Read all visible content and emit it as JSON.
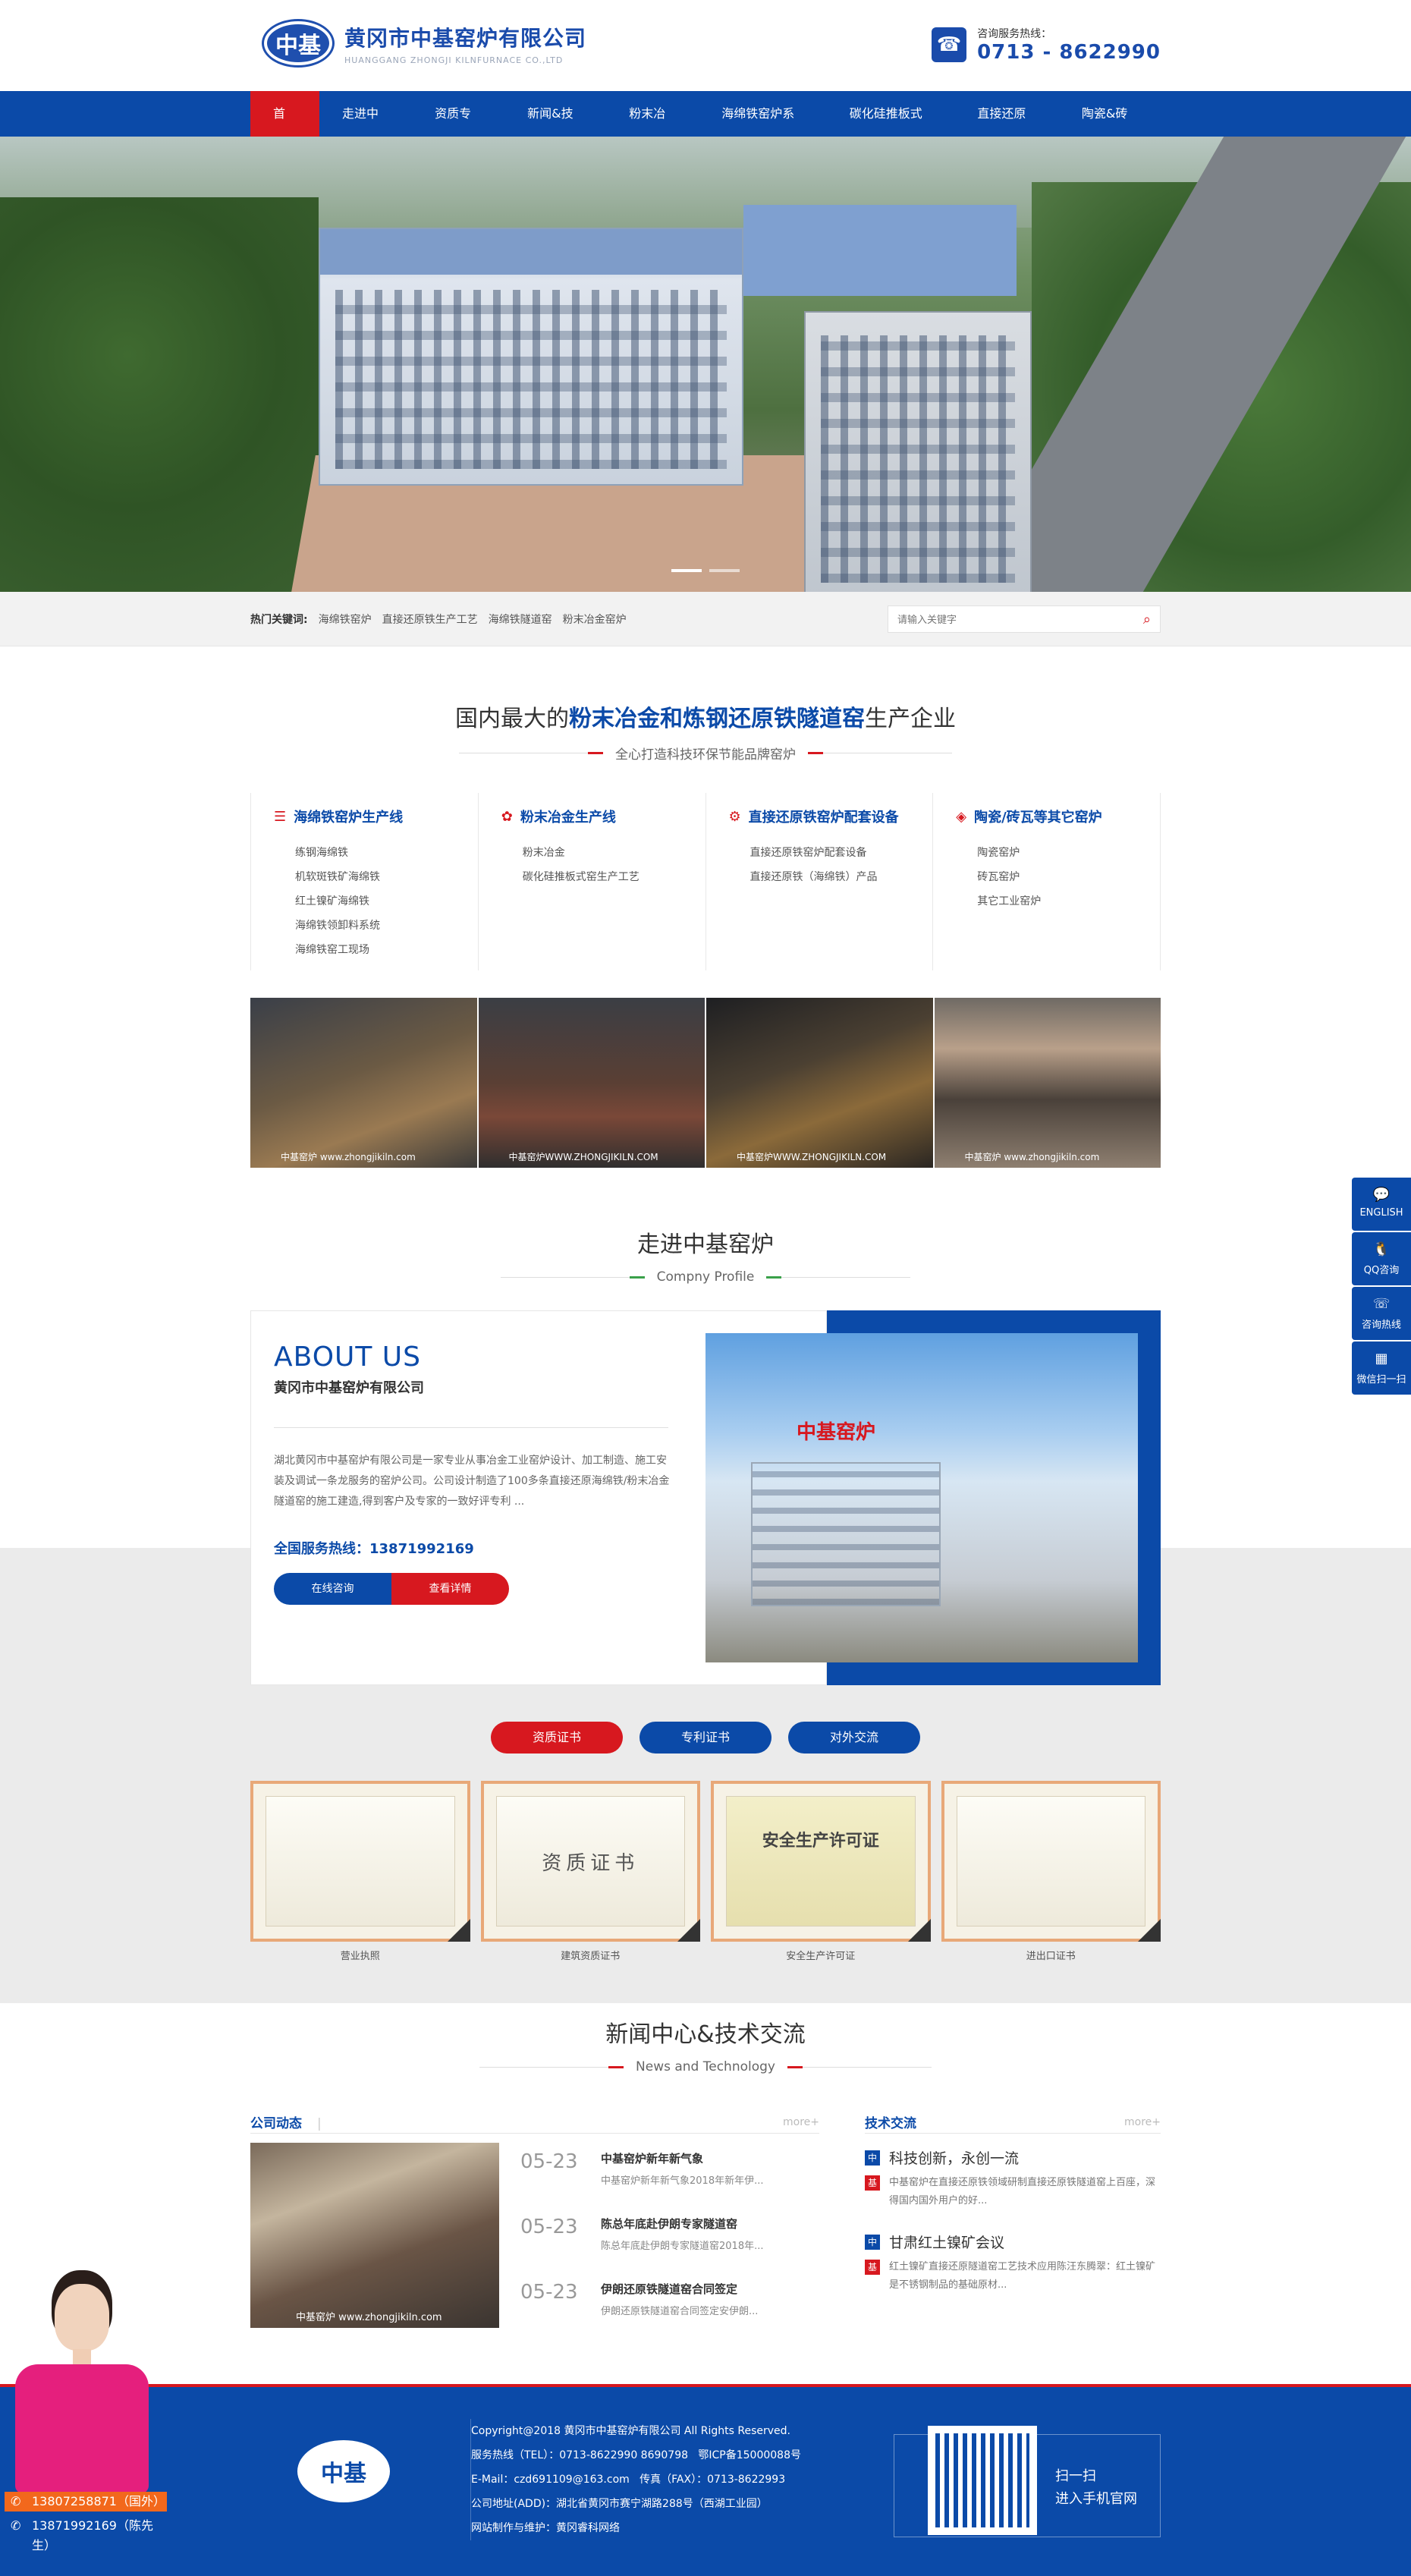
{
  "header": {
    "logo_mark": "中基",
    "company_cn": "黄冈市中基窑炉有限公司",
    "company_en": "HUANGGANG ZHONGJI KILNFURNACE CO.,LTD",
    "hotline_label": "咨询服务热线：",
    "hotline_number": "0713 - 8622990",
    "phone_icon": "telephone-icon"
  },
  "nav": {
    "items": [
      {
        "label": "首页",
        "active": true
      },
      {
        "label": "走进中基"
      },
      {
        "label": "资质专利"
      },
      {
        "label": "新闻&技术"
      },
      {
        "label": "粉末冶金"
      },
      {
        "label": "海绵铁窑炉系列"
      },
      {
        "label": "碳化硅推板式窑"
      },
      {
        "label": "直接还原铁"
      },
      {
        "label": "陶瓷&砖瓦"
      }
    ]
  },
  "search": {
    "hot_label": "热门关键词:",
    "hot_words": [
      "海绵铁窑炉",
      "直接还原铁生产工艺",
      "海绵铁隧道窑",
      "粉末冶金窑炉"
    ],
    "placeholder": "请输入关键字",
    "icon": "search-icon"
  },
  "products": {
    "title_pre": "国内最大的",
    "title_hl": "粉末冶金和炼钢还原铁隧道窑",
    "title_post": "生产企业",
    "subtitle": "全心打造科技环保节能品牌窑炉",
    "categories": [
      {
        "title": "海绵铁窑炉生产线",
        "icon": "list-icon",
        "items": [
          "练钢海绵铁",
          "机软斑铁矿海绵铁",
          "红土镍矿海绵铁",
          "海绵铁领卸料系统",
          "海绵铁窑工现场"
        ]
      },
      {
        "title": "粉末冶金生产线",
        "icon": "flower-icon",
        "items": [
          "粉末冶金",
          "碳化硅推板式窑生产工艺"
        ]
      },
      {
        "title": "直接还原铁窑炉配套设备",
        "icon": "gear-icon",
        "items": [
          "直接还原铁窑炉配套设备",
          "直接还原铁（海绵铁）产品"
        ]
      },
      {
        "title": "陶瓷/砖瓦等其它窑炉",
        "icon": "tag-icon",
        "items": [
          "陶瓷窑炉",
          "砖瓦窑炉",
          "其它工业窑炉"
        ]
      }
    ],
    "photo_watermarks": [
      "中基窑炉 www.zhongjikiln.com",
      "中基窑炉WWW.ZHONGJIKILN.COM",
      "中基窑炉WWW.ZHONGJIKILN.COM",
      "中基窑炉 www.zhongjikiln.com"
    ]
  },
  "about": {
    "title": "走进中基窑炉",
    "subtitle": "Compny Profile",
    "heading_en": "ABOUT US",
    "heading_cn": "黄冈市中基窑炉有限公司",
    "intro": "湖北黄冈市中基窑炉有限公司是一家专业从事冶金工业窑炉设计、加工制造、施工安装及调试一条龙服务的窑炉公司。公司设计制造了100多条直接还原海绵铁/粉末冶金隧道窑的施工建造,得到客户及专家的一致好评专利 ...",
    "tel_label": "全国服务热线：",
    "tel_number": "13871992169",
    "btn_consult": "在线咨询",
    "btn_detail": "查看详情",
    "sign": "中基窑炉"
  },
  "certs": {
    "tabs": [
      "资质证书",
      "专利证书",
      "对外交流"
    ],
    "items": [
      "营业执照",
      "建筑资质证书",
      "安全生产许可证",
      "进出口证书"
    ],
    "doc_title_2": "资质证书",
    "doc_title_3": "安全生产许可证"
  },
  "news": {
    "title": "新闻中心&技术交流",
    "subtitle": "News and Technology",
    "company_head": "公司动态",
    "company_sep": "|",
    "tech_head": "技术交流",
    "more": "more+",
    "image_watermark": "中基窑炉 www.zhongjikiln.com",
    "company_items": [
      {
        "date": "05-23",
        "title": "中基窑炉新年新气象",
        "desc": "中基窑炉新年新气象2018年新年伊..."
      },
      {
        "date": "05-23",
        "title": "陈总年底赴伊朗专家隧道窑",
        "desc": "陈总年底赴伊朗专家隧道窑2018年..."
      },
      {
        "date": "05-23",
        "title": "伊朗还原铁隧道窑合同签定",
        "desc": "伊朗还原铁隧道窑合同签定安伊朗..."
      }
    ],
    "tech_items": [
      {
        "q": "中",
        "a": "基",
        "title": "科技创新，永创一流",
        "desc": "中基窑炉在直接还原铁领域研制直接还原铁隧道窑上百座，深得国内国外用户的好..."
      },
      {
        "q": "中",
        "a": "基",
        "title": "甘肃红土镍矿会议",
        "desc": "红土镍矿直接还原隧道窑工艺技术应用陈汪东腾翠：红土镍矿是不锈钢制品的基础原材..."
      }
    ]
  },
  "footer": {
    "logo_mark": "中基",
    "copyright": "Copyright@2018 黄冈市中基窑炉有限公司 All Rights Reserved.",
    "tel": "服务热线（TEL）：0713-8622990 8690798",
    "icp": "鄂ICP备15000088号",
    "email": "E-Mail：czd691109@163.com",
    "fax": "传真（FAX）：0713-8622993",
    "address": "公司地址(ADD)：湖北省黄冈市赛宁湖路288号（西湖工业园）",
    "maker": "网站制作与维护：黄冈睿科网络",
    "qr_line1": "扫一扫",
    "qr_line2": "进入手机官网"
  },
  "side": [
    {
      "icon": "chat-icon",
      "label": "ENGLISH"
    },
    {
      "icon": "qq-icon",
      "label": "QQ咨询"
    },
    {
      "icon": "phone-icon",
      "label": "咨询热线"
    },
    {
      "icon": "qrcode-icon",
      "label": "微信扫一扫"
    }
  ],
  "cs": {
    "phone1": "13807258871（国外）",
    "phone2": "13871992169（陈先生）"
  },
  "colors": {
    "brand_blue": "#0b4aa8",
    "accent_red": "#d7181f"
  }
}
